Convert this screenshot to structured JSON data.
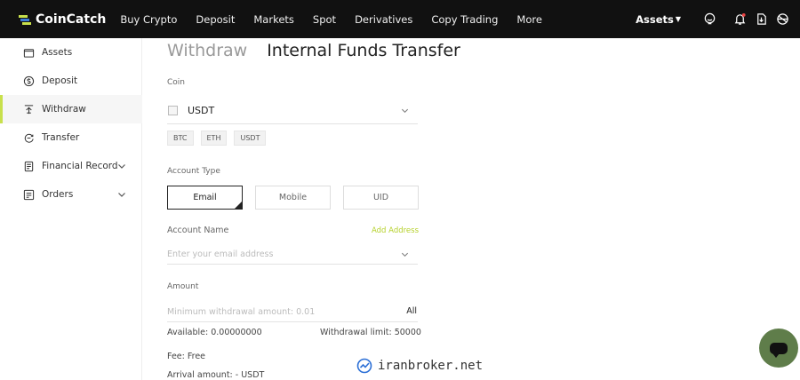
{
  "header": {
    "logo_text": "CoinCatch",
    "nav": [
      "Buy Crypto",
      "Deposit",
      "Markets",
      "Spot",
      "Derivatives",
      "Copy Trading",
      "More"
    ],
    "assets_label": "Assets",
    "icons": [
      "support-icon",
      "bell-icon",
      "download-icon",
      "globe-icon"
    ]
  },
  "sidebar": {
    "items": [
      {
        "label": "Assets",
        "icon": "wallet-icon"
      },
      {
        "label": "Deposit",
        "icon": "dollar-circle-icon"
      },
      {
        "label": "Withdraw",
        "icon": "upload-icon",
        "active": true
      },
      {
        "label": "Transfer",
        "icon": "transfer-icon"
      },
      {
        "label": "Financial Record",
        "icon": "record-icon",
        "expandable": true
      },
      {
        "label": "Orders",
        "icon": "orders-icon",
        "expandable": true
      }
    ],
    "accent_color": "#c8e04c"
  },
  "main": {
    "tabs": [
      "Withdraw",
      "Internal Funds Transfer"
    ],
    "coin_label": "Coin",
    "coin_selected": "USDT",
    "coin_chips": [
      "BTC",
      "ETH",
      "USDT"
    ],
    "account_type_label": "Account Type",
    "account_types": [
      "Email",
      "Mobile",
      "UID"
    ],
    "account_name_label": "Account Name",
    "add_address": "Add Address",
    "email_placeholder": "Enter your email address",
    "amount_label": "Amount",
    "amount_placeholder": "Minimum withdrawal amount: 0.01",
    "all_label": "All",
    "available": "Available: 0.00000000",
    "withdrawal_limit": "Withdrawal limit: 50000",
    "fee": "Fee: Free",
    "arrival": "Arrival amount: - USDT"
  },
  "watermark": "iranbroker.net",
  "colors": {
    "nav_bg": "#111111",
    "accent": "#c8e04c",
    "chat_fab": "#5f7d4a"
  }
}
